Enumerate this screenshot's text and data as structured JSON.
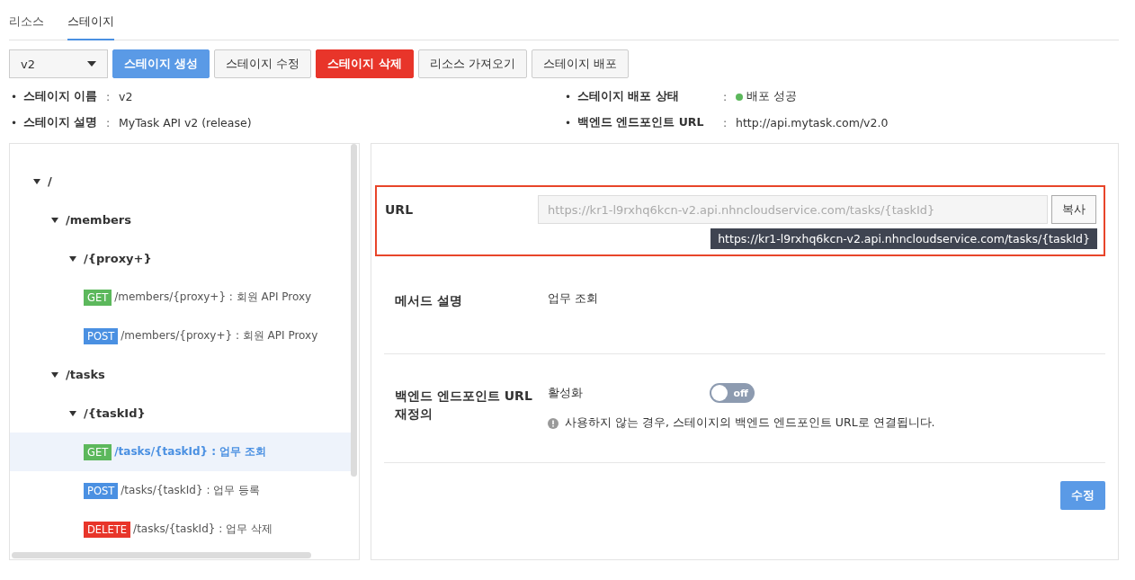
{
  "tabs": [
    {
      "label": "리소스",
      "selected": false
    },
    {
      "label": "스테이지",
      "selected": true
    }
  ],
  "toolbar": {
    "stage_select": {
      "value": "v2"
    },
    "buttons": [
      {
        "label": "스테이지 생성",
        "kind": "primary"
      },
      {
        "label": "스테이지 수정",
        "kind": "default"
      },
      {
        "label": "스테이지 삭제",
        "kind": "danger"
      },
      {
        "label": "리소스 가져오기",
        "kind": "default"
      },
      {
        "label": "스테이지 배포",
        "kind": "default"
      }
    ]
  },
  "stage_info": [
    {
      "bullet": "•",
      "label": "스테이지 이름",
      "separator": ":",
      "value": "v2",
      "kind": "text"
    },
    {
      "bullet": "•",
      "label": "스테이지 배포 상태",
      "separator": ":",
      "value": "배포 성공",
      "kind": "status",
      "color": "#5cb85c"
    },
    {
      "bullet": "•",
      "label": "스테이지 설명",
      "separator": ":",
      "value": "MyTask API v2 (release)",
      "kind": "text"
    },
    {
      "bullet": "•",
      "label": "백엔드 엔드포인트 URL",
      "separator": ":",
      "value": "http://api.mytask.com/v2.0",
      "kind": "text"
    }
  ],
  "resource_tree": [
    {
      "kind": "folder",
      "label": "/",
      "expanded": true,
      "children": [
        {
          "kind": "folder",
          "label": "/members",
          "expanded": true,
          "children": [
            {
              "kind": "folder",
              "label": "/{proxy+}",
              "expanded": true,
              "children": [
                {
                  "kind": "method",
                  "method": "GET",
                  "color": "#5cb85c",
                  "label": "/members/{proxy+} : 회원 API Proxy",
                  "selected": false
                },
                {
                  "kind": "method",
                  "method": "POST",
                  "color": "#4a90e2",
                  "label": "/members/{proxy+} : 회원 API Proxy",
                  "selected": false
                }
              ]
            }
          ]
        },
        {
          "kind": "folder",
          "label": "/tasks",
          "expanded": true,
          "children": [
            {
              "kind": "folder",
              "label": "/{taskId}",
              "expanded": true,
              "children": [
                {
                  "kind": "method",
                  "method": "GET",
                  "color": "#5cb85c",
                  "label": "/tasks/{taskId} : 업무 조회",
                  "selected": true
                },
                {
                  "kind": "method",
                  "method": "POST",
                  "color": "#4a90e2",
                  "label": "/tasks/{taskId} : 업무 등록",
                  "selected": false
                },
                {
                  "kind": "method",
                  "method": "DELETE",
                  "color": "#e8352a",
                  "label": "/tasks/{taskId} : 업무 삭제",
                  "selected": false
                }
              ]
            }
          ]
        }
      ]
    }
  ],
  "detail": {
    "url": {
      "label": "URL",
      "value": "https://kr1-l9rxhq6kcn-v2.api.nhncloudservice.com/tasks/{taskId}",
      "disabled": true,
      "highlighted": true,
      "copy_button": "복사",
      "tooltip": "https://kr1-l9rxhq6kcn-v2.api.nhncloudservice.com/tasks/{taskId}"
    },
    "method_description": {
      "label": "메서드 설명",
      "value": "업무 조회"
    },
    "backend_override": {
      "label": "백엔드 엔드포인트 URL 재정의",
      "toggle_label": "활성화",
      "on": false,
      "toggle_text": "off",
      "note": "사용하지 않는 경우, 스테이지의 백엔드 엔드포인트 URL로 연결됩니다."
    },
    "submit_button": "수정"
  }
}
